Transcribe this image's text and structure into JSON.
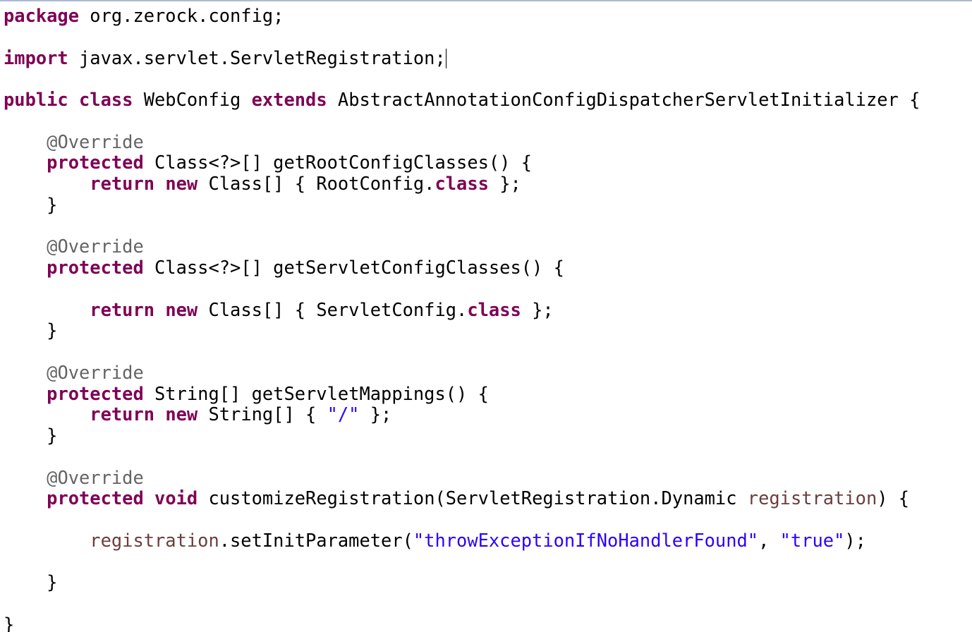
{
  "colors": {
    "keyword": "#7f0055",
    "annotation": "#646464",
    "string": "#2a00ff",
    "variable": "#6a3e3e",
    "text": "#000000"
  },
  "lines": [
    [
      {
        "t": "kw",
        "v": "package"
      },
      {
        "t": "",
        "v": " org.zerock.config;"
      }
    ],
    [],
    [
      {
        "t": "kw",
        "v": "import"
      },
      {
        "t": "",
        "v": " javax.servlet.ServletRegistration;"
      },
      {
        "t": "caret",
        "v": ""
      }
    ],
    [],
    [
      {
        "t": "kw",
        "v": "public"
      },
      {
        "t": "",
        "v": " "
      },
      {
        "t": "kw",
        "v": "class"
      },
      {
        "t": "",
        "v": " WebConfig "
      },
      {
        "t": "kw",
        "v": "extends"
      },
      {
        "t": "",
        "v": " AbstractAnnotationConfigDispatcherServletInitializer {"
      }
    ],
    [],
    [
      {
        "t": "",
        "v": "    "
      },
      {
        "t": "ann",
        "v": "@Override"
      }
    ],
    [
      {
        "t": "",
        "v": "    "
      },
      {
        "t": "kw",
        "v": "protected"
      },
      {
        "t": "",
        "v": " Class<?>[] getRootConfigClasses() {"
      }
    ],
    [
      {
        "t": "",
        "v": "        "
      },
      {
        "t": "kw",
        "v": "return"
      },
      {
        "t": "",
        "v": " "
      },
      {
        "t": "kw",
        "v": "new"
      },
      {
        "t": "",
        "v": " Class[] { RootConfig."
      },
      {
        "t": "kw",
        "v": "class"
      },
      {
        "t": "",
        "v": " };"
      }
    ],
    [
      {
        "t": "",
        "v": "    }"
      }
    ],
    [],
    [
      {
        "t": "",
        "v": "    "
      },
      {
        "t": "ann",
        "v": "@Override"
      }
    ],
    [
      {
        "t": "",
        "v": "    "
      },
      {
        "t": "kw",
        "v": "protected"
      },
      {
        "t": "",
        "v": " Class<?>[] getServletConfigClasses() {"
      }
    ],
    [],
    [
      {
        "t": "",
        "v": "        "
      },
      {
        "t": "kw",
        "v": "return"
      },
      {
        "t": "",
        "v": " "
      },
      {
        "t": "kw",
        "v": "new"
      },
      {
        "t": "",
        "v": " Class[] { ServletConfig."
      },
      {
        "t": "kw",
        "v": "class"
      },
      {
        "t": "",
        "v": " };"
      }
    ],
    [
      {
        "t": "",
        "v": "    }"
      }
    ],
    [],
    [
      {
        "t": "",
        "v": "    "
      },
      {
        "t": "ann",
        "v": "@Override"
      }
    ],
    [
      {
        "t": "",
        "v": "    "
      },
      {
        "t": "kw",
        "v": "protected"
      },
      {
        "t": "",
        "v": " String[] getServletMappings() {"
      }
    ],
    [
      {
        "t": "",
        "v": "        "
      },
      {
        "t": "kw",
        "v": "return"
      },
      {
        "t": "",
        "v": " "
      },
      {
        "t": "kw",
        "v": "new"
      },
      {
        "t": "",
        "v": " String[] { "
      },
      {
        "t": "str",
        "v": "\"/\""
      },
      {
        "t": "",
        "v": " };"
      }
    ],
    [
      {
        "t": "",
        "v": "    }"
      }
    ],
    [],
    [
      {
        "t": "",
        "v": "    "
      },
      {
        "t": "ann",
        "v": "@Override"
      }
    ],
    [
      {
        "t": "",
        "v": "    "
      },
      {
        "t": "kw",
        "v": "protected"
      },
      {
        "t": "",
        "v": " "
      },
      {
        "t": "kw",
        "v": "void"
      },
      {
        "t": "",
        "v": " customizeRegistration(ServletRegistration.Dynamic "
      },
      {
        "t": "var",
        "v": "registration"
      },
      {
        "t": "",
        "v": ") {"
      }
    ],
    [],
    [
      {
        "t": "",
        "v": "        "
      },
      {
        "t": "var",
        "v": "registration"
      },
      {
        "t": "",
        "v": ".setInitParameter("
      },
      {
        "t": "str",
        "v": "\"throwExceptionIfNoHandlerFound\""
      },
      {
        "t": "",
        "v": ", "
      },
      {
        "t": "str",
        "v": "\"true\""
      },
      {
        "t": "",
        "v": ");"
      }
    ],
    [],
    [
      {
        "t": "",
        "v": "    }"
      }
    ],
    [],
    [
      {
        "t": "",
        "v": "}"
      }
    ]
  ]
}
